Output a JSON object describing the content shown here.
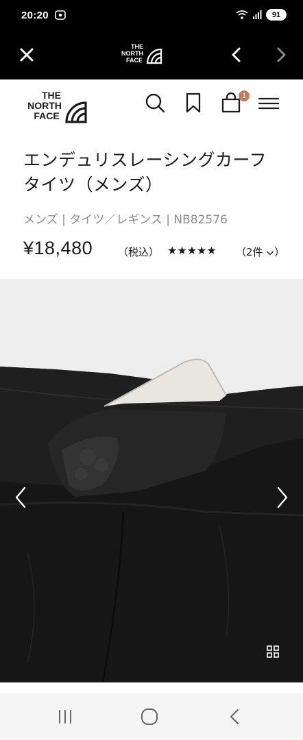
{
  "status_bar": {
    "time": "20:20",
    "battery": "91"
  },
  "browser": {
    "logo_text": [
      "THE",
      "NORTH",
      "FACE"
    ]
  },
  "site": {
    "logo_text": [
      "THE",
      "NORTH",
      "FACE"
    ],
    "cart_count": "1"
  },
  "product": {
    "title": "エンデュリスレーシングカーフタイツ（メンズ）",
    "breadcrumb": "メンズ | タイツ／レギンス | NB82576",
    "price": "¥18,480",
    "tax": "（税込）",
    "stars": "★★★★★",
    "rating": 5,
    "reviews": "（2件",
    "review_chevron": "chevron-down-icon"
  },
  "colors": {
    "bars": "#000000",
    "badge": "#c47b5c",
    "gallery_bg": "#eeeeee",
    "muted_text": "#8c8c8c"
  }
}
